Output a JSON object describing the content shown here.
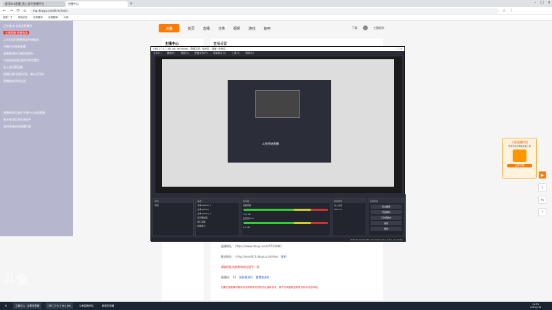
{
  "browser": {
    "tabs": [
      {
        "label": "虎牙live直播_直上虎牙直播平台"
      },
      {
        "label": "主播中心"
      }
    ],
    "url": "mp.douyu.com/live/room",
    "bookmarks": [
      "百度一下",
      "导航站点",
      "页面缓存",
      "百度翻译",
      "火狐"
    ]
  },
  "site": {
    "logo": "斗鱼",
    "nav": [
      "首页",
      "直播",
      "分类",
      "视频",
      "游戏",
      "鱼吧"
    ],
    "user_label": "下载",
    "username": "主播昵称"
  },
  "sidebar": {
    "title": "主播中心"
  },
  "content": {
    "title": "直播设置"
  },
  "overlay": {
    "lines": [
      "正在推流·未完成直播时",
      "点击(关闭)直播画面开始推流",
      "开播后在观看直播",
      "复制推流码与服务器地址",
      "分别粘贴到推流软件的设置页",
      "右上角设置直播",
      "直播分类/标题/封面，确认后开始",
      "直播结束及时关闭"
    ],
    "highlight": "主播直播·直播推流",
    "bottom": [
      "直播结束后请在主播中心关闭直播",
      "断开推流后再关闭软件",
      "请勿直接关闭直播页面"
    ]
  },
  "obs": {
    "title": "OBS 27.0.1 (64-bit, windows) - 配置文件: 未命名 - 场景: 未命名",
    "menu": [
      "文件(F)",
      "编辑(E)",
      "视图(V)",
      "配置文件(P)",
      "场景集合(S)",
      "工具(T)",
      "帮助(H)"
    ],
    "inner_label": "斗鱼开始直播",
    "scenes_header": "场景",
    "scenes": [
      "场景"
    ],
    "sources_header": "来源",
    "sources": [
      "文本 (GDI+) 2",
      "文本 (GDI+)",
      "文本 (GDI+) 3",
      "显示器采集",
      "窗口采集",
      "媒体源 1"
    ],
    "mixer_header": "混音器",
    "mixer": [
      {
        "name": "桌面音频",
        "db": "-2.0 dB"
      },
      {
        "name": "麦克风/Aux",
        "db": "0.0 dB"
      }
    ],
    "transitions_header": "转场特效",
    "transition": "淡入淡出",
    "duration": "300 ms",
    "controls_header": "控制按钮",
    "controls": [
      "停止推流",
      "开始录制",
      "工作室模式",
      "设置",
      "退出"
    ],
    "status": "LIVE: 00:00:00  REC: 00:00:00  CPU: 2.2%, 30.00 fps"
  },
  "below": {
    "url_label": "直播地址:",
    "url_value": "https://www.douyu.com/5574980",
    "push_label": "推流地址:",
    "push_value": "rtmp://sendtc3.douyu.com/live",
    "copy_btn": "复制",
    "push_note": "请确保推流参数和地址填写一致",
    "code_label": "直播码:",
    "code_value": "12",
    "copy_code": "复制推流码",
    "reset_code": "重置推流码",
    "warning": "如果出现直播问题请尝试刷新或关闭推流后重新推流，断开后请重新复制推流码并检查网络。"
  },
  "promo": {
    "title": "斗鱼直播伴侣",
    "text": "支持手机和电脑直播工具",
    "btn": "立即下载"
  },
  "taskbar": {
    "items": [
      "主播中心 - 谷歌浏览器",
      "OBS 27.0.1 (64-bit)",
      "斗鱼直播伴侣",
      "音频控制器"
    ],
    "time": "14:21",
    "date": "2021/7/6"
  },
  "watermark": "斗鱼"
}
